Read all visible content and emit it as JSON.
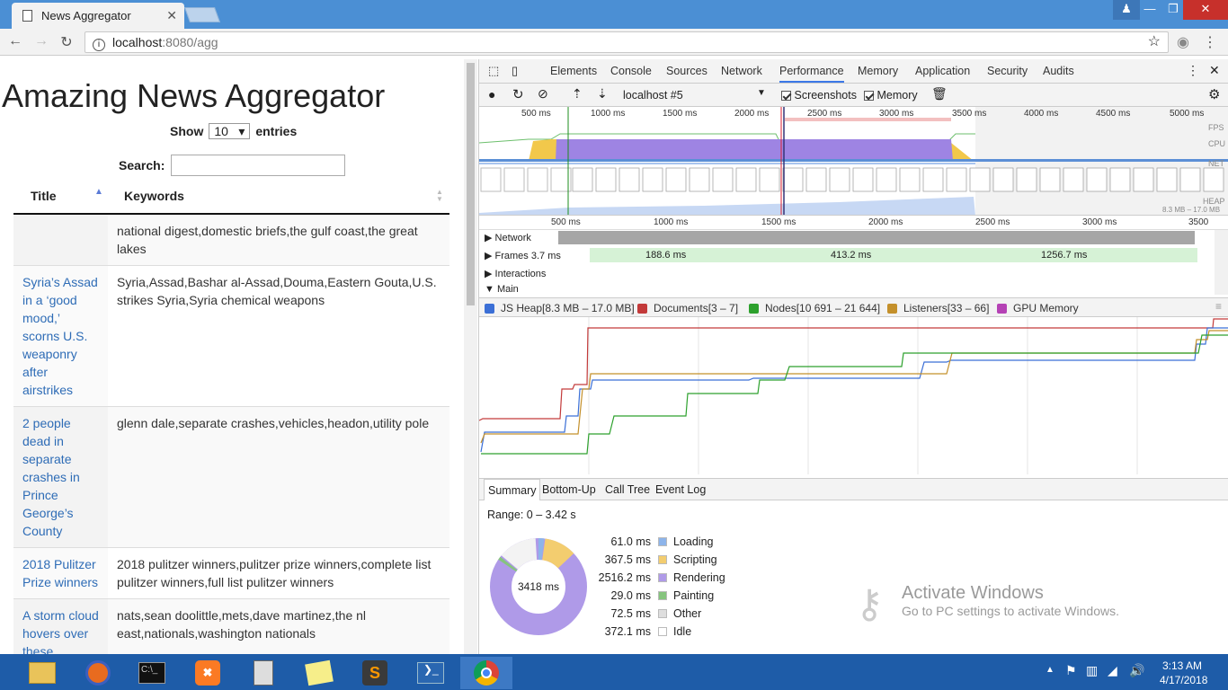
{
  "browser": {
    "tab_title": "News Aggregator",
    "url_host": "localhost",
    "url_path": ":8080/agg",
    "window_minimize": "—",
    "window_restore": "❐",
    "window_close": "✕",
    "back": "←",
    "forward": "→",
    "reload": "↻",
    "star": "☆",
    "menu": "⋮"
  },
  "page": {
    "title": "Amazing News Aggregator",
    "show_label": "Show",
    "show_value": "10",
    "entries_label": "entries",
    "search_label": "Search:",
    "col_title": "Title",
    "col_keywords": "Keywords",
    "rows": [
      {
        "title": "",
        "keywords": "national digest,domestic briefs,the gulf coast,the great lakes"
      },
      {
        "title": "Syria’s Assad in a ‘good mood,’ scorns U.S. weaponry after airstrikes",
        "keywords": "Syria,Assad,Bashar al-Assad,Douma,Eastern Gouta,U.S. strikes Syria,Syria chemical weapons"
      },
      {
        "title": "2 people dead in separate crashes in Prince George’s County",
        "keywords": "glenn dale,separate crashes,vehicles,headon,utility pole"
      },
      {
        "title": "2018 Pulitzer Prize winners",
        "keywords": "2018 pulitzer winners,pulitzer prize winners,complete list pulitzer winners,full list pulitzer winners"
      },
      {
        "title": "A storm cloud hovers over these",
        "keywords": "nats,sean doolittle,mets,dave martinez,the nl east,nationals,washington nationals"
      }
    ]
  },
  "devtools": {
    "tabs": [
      "Elements",
      "Console",
      "Sources",
      "Network",
      "Performance",
      "Memory",
      "Application",
      "Security",
      "Audits"
    ],
    "active_tab": "Performance",
    "profile": "localhost #5",
    "screenshots_label": "Screenshots",
    "memory_label": "Memory",
    "overview_ticks": [
      "500 ms",
      "1000 ms",
      "1500 ms",
      "2000 ms",
      "2500 ms",
      "3000 ms",
      "3500 ms",
      "4000 ms",
      "4500 ms",
      "5000 ms"
    ],
    "overview_labels": [
      "FPS",
      "CPU",
      "NET",
      "HEAP"
    ],
    "heap_range": "8.3 MB – 17.0 MB",
    "timeline_ticks": [
      "500 ms",
      "1000 ms",
      "1500 ms",
      "2000 ms",
      "2500 ms",
      "3000 ms",
      "3500"
    ],
    "tracks": {
      "network": "Network",
      "frames": "Frames",
      "frames_val": "3.7 ms",
      "interactions": "Interactions",
      "main": "Main",
      "f1": "188.6 ms",
      "f2": "413.2 ms",
      "f3": "1256.7 ms"
    },
    "legend": [
      {
        "label": "JS Heap[8.3 MB – 17.0 MB]",
        "color": "#3b6fd6"
      },
      {
        "label": "Documents[3 – 7]",
        "color": "#c33a3a"
      },
      {
        "label": "Nodes[10 691 – 21 644]",
        "color": "#2da12d"
      },
      {
        "label": "Listeners[33 – 66]",
        "color": "#c4902b"
      },
      {
        "label": "GPU Memory",
        "color": "#b542b5"
      }
    ],
    "bottom_tabs": [
      "Summary",
      "Bottom-Up",
      "Call Tree",
      "Event Log"
    ],
    "range": "Range: 0 – 3.42 s",
    "total": "3418 ms",
    "summary": [
      {
        "value": "61.0 ms",
        "label": "Loading",
        "color": "#8db4ea"
      },
      {
        "value": "367.5 ms",
        "label": "Scripting",
        "color": "#f3cd6f"
      },
      {
        "value": "2516.2 ms",
        "label": "Rendering",
        "color": "#af9ae8"
      },
      {
        "value": "29.0 ms",
        "label": "Painting",
        "color": "#86c47e"
      },
      {
        "value": "72.5 ms",
        "label": "Other",
        "color": "#dedede"
      },
      {
        "value": "372.1 ms",
        "label": "Idle",
        "color": "#ffffff"
      }
    ],
    "activate_title": "Activate Windows",
    "activate_sub": "Go to PC settings to activate Windows."
  },
  "taskbar": {
    "time": "3:13 AM",
    "date": "4/17/2018"
  }
}
